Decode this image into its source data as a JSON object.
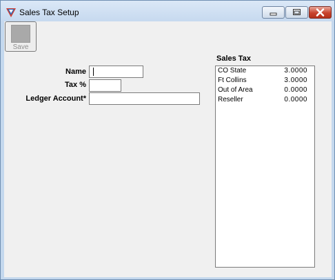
{
  "window": {
    "title": "Sales Tax Setup"
  },
  "toolbar": {
    "save_label": "Save"
  },
  "form": {
    "name_label": "Name",
    "name_value": "",
    "tax_label": "Tax %",
    "tax_value": "",
    "ledger_label": "Ledger Account*",
    "ledger_value": ""
  },
  "sales_tax": {
    "title": "Sales Tax",
    "items": [
      {
        "name": "CO State",
        "rate": "3.0000"
      },
      {
        "name": "Ft Collins",
        "rate": "3.0000"
      },
      {
        "name": "Out of Area",
        "rate": "0.0000"
      },
      {
        "name": "Reseller",
        "rate": "0.0000"
      }
    ]
  },
  "icons": {
    "app": "sales-tax-app-icon",
    "minimize": "minimize-icon",
    "maximize": "maximize-icon",
    "close": "close-icon"
  }
}
